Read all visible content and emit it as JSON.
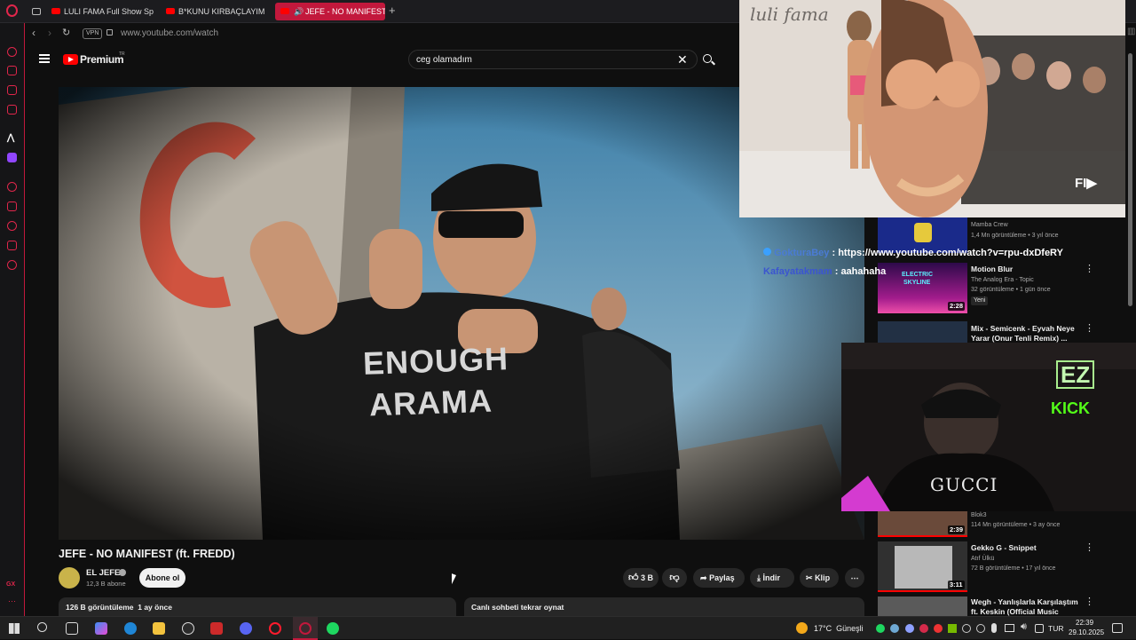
{
  "tabs": [
    {
      "label": "LULI FAMA Full Show Sp"
    },
    {
      "label": "B*KUNU KIRBAÇLAYIM"
    },
    {
      "label": "JEFE - NO MANIFEST"
    }
  ],
  "address": {
    "vpn": "VPN",
    "url": "www.youtube.com/watch"
  },
  "youtube": {
    "logo": "Premium",
    "logo_sup": "TR",
    "search_value": "ceg olamadım"
  },
  "video": {
    "title": "JEFE - NO MANIFEST (ft. FREDD)",
    "channel": "EL JEFE",
    "subscribers": "12,3 B abone",
    "subscribe_label": "Abone ol",
    "likes": "3 B",
    "share_label": "Paylaş",
    "download_label": "İndir",
    "clip_label": "Klip",
    "views_line": "126 B görüntüleme  1 ay önce",
    "live_chat_label": "Canlı sohbeti tekrar oynat",
    "shirt_text_1": "ENOUGH",
    "shirt_text_2": "ARAMA"
  },
  "pip1": {
    "watermark": "luli fama",
    "corner_logo": "FI▶"
  },
  "pip2": {
    "logo": "EZ",
    "kick": "KICK",
    "shirt": "GUCCI"
  },
  "chat": [
    {
      "user": "GokturaBey",
      "message": ": https://www.youtube.com/watch?v=rpu-dxDfeRY"
    },
    {
      "user": "Kafayatakmam",
      "message": ": aahahaha"
    }
  ],
  "recommendations": [
    {
      "title": "",
      "channel": "Mamba Crew",
      "meta": "1,4 Mn görüntüleme • 3 yıl önce",
      "duration": "",
      "badge": ""
    },
    {
      "title": "Motion Blur",
      "channel": "The Analog Era - Topic",
      "meta": "32 görüntüleme • 1 gün önce",
      "duration": "2:28",
      "badge": "Yeni"
    },
    {
      "title": "Mix - Semicenk - Eyvah Neye Yarar (Onur Tenli Remix) ...",
      "channel": "",
      "meta": "",
      "duration": "",
      "badge": ""
    },
    {
      "title": "",
      "channel": "Blok3",
      "meta": "114 Mn görüntüleme • 3 ay önce",
      "duration": "2:39",
      "badge": ""
    },
    {
      "title": "Gekko G - Snippet",
      "channel": "Atıf Ülkü",
      "meta": "72 B görüntüleme • 17 yıl önce",
      "duration": "3:11",
      "badge": ""
    },
    {
      "title": "Wegh - Yanlışlarla Karşılaştım ft. Keskin (Official Music Video)",
      "channel": "",
      "meta": "",
      "duration": "",
      "badge": ""
    }
  ],
  "thumb_texts": {
    "electric_skyline_1": "ELECTRIC",
    "electric_skyline_2": "SKYLINE"
  },
  "taskbar": {
    "weather": "17°C  Güneşli",
    "lang": "TUR",
    "time": "22:39",
    "date": "29.10.2025"
  },
  "sidebar_bottom": "GX",
  "colors": {
    "accent": "#c2183c",
    "yt_red": "#ff0000",
    "bg": "#0f0f0f"
  }
}
